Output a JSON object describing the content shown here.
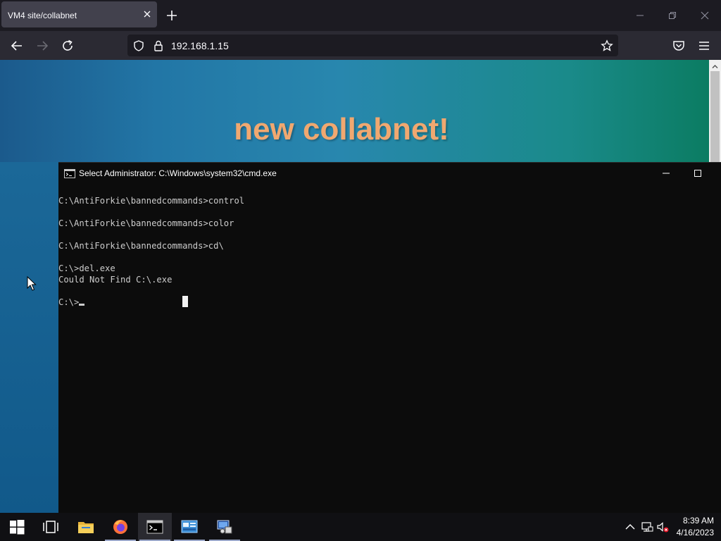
{
  "browser": {
    "tab_title": "VM4 site/collabnet",
    "url": "192.168.1.15"
  },
  "webpage": {
    "heading": "new collabnet!"
  },
  "cmd": {
    "title": "Select Administrator: C:\\Windows\\system32\\cmd.exe",
    "lines": [
      "C:\\AntiForkie\\bannedcommands>control",
      "",
      "C:\\AntiForkie\\bannedcommands>color",
      "",
      "C:\\AntiForkie\\bannedcommands>cd\\",
      "",
      "C:\\>del.exe",
      "Could Not Find C:\\.exe",
      "",
      "C:\\>"
    ]
  },
  "taskbar": {
    "items": [
      "start-icon",
      "task-view-icon",
      "file-explorer-icon",
      "firefox-icon",
      "cmd-icon",
      "control-panel-icon",
      "network-admin-icon"
    ],
    "time": "8:39 AM",
    "date": "4/16/2023"
  },
  "colors": {
    "browser_chrome": "#1c1b22",
    "navbar": "#2b2a33",
    "heading": "#f0a870",
    "cmd_bg": "#0c0c0c",
    "cmd_text": "#cccccc",
    "taskbar": "#101013"
  }
}
